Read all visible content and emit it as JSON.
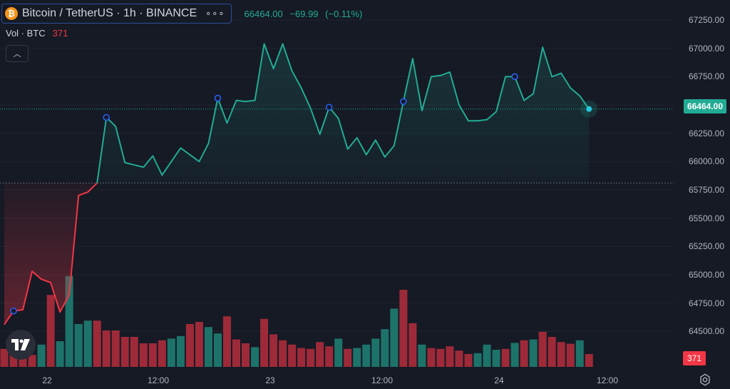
{
  "header": {
    "symbol_title": "Bitcoin / TetherUS · 1h · BINANCE",
    "coin_glyph": "₿",
    "more_glyph": "∘∘∘",
    "last": "66464.00",
    "change": "−69.99",
    "change_pct": "(−0.11%)"
  },
  "volume_legend": {
    "label": "Vol · BTC",
    "value": "371"
  },
  "collapse_glyph": "︿",
  "price_axis": {
    "ticks": [
      "67250.00",
      "67000.00",
      "66750.00",
      "66500.00",
      "66250.00",
      "66000.00",
      "65750.00",
      "65500.00",
      "65250.00",
      "65000.00",
      "64750.00",
      "64500.00"
    ],
    "current_price_label": "66464.00",
    "current_volume_label": "371"
  },
  "time_axis": {
    "ticks": [
      "22",
      "12:00",
      "23",
      "12:00",
      "24",
      "12:00"
    ]
  },
  "colors": {
    "up": "#22ab94",
    "down": "#f23645",
    "background": "#161a25"
  },
  "chart_data": {
    "type": "line",
    "title": "Bitcoin / TetherUS · 1h · BINANCE",
    "ylim": [
      64400,
      67320
    ],
    "baseline": 65810,
    "price": [
      64560,
      64680,
      64690,
      65030,
      64960,
      64930,
      64670,
      64820,
      65700,
      65730,
      65810,
      66390,
      66310,
      65990,
      65970,
      65950,
      66050,
      65880,
      66000,
      66120,
      66060,
      66000,
      66160,
      66560,
      66340,
      66540,
      66530,
      66540,
      67040,
      66820,
      67040,
      66800,
      66650,
      66470,
      66240,
      66480,
      66380,
      66110,
      66210,
      66060,
      66190,
      66040,
      66140,
      66530,
      66910,
      66450,
      66750,
      66760,
      66790,
      66500,
      66360,
      66360,
      66370,
      66440,
      66750,
      66750,
      66540,
      66600,
      67010,
      66750,
      66780,
      66650,
      66580,
      66464
    ],
    "volume": [
      42,
      30,
      38,
      28,
      52,
      168,
      60,
      212,
      100,
      108,
      108,
      85,
      85,
      70,
      70,
      55,
      55,
      62,
      66,
      72,
      100,
      105,
      93,
      78,
      118,
      64,
      55,
      46,
      112,
      76,
      62,
      52,
      44,
      42,
      58,
      48,
      66,
      42,
      44,
      52,
      66,
      88,
      136,
      180,
      102,
      52,
      44,
      42,
      48,
      38,
      30,
      32,
      52,
      40,
      42,
      56,
      62,
      64,
      82,
      70,
      58,
      54,
      62,
      30
    ],
    "bar_colors": [
      "d",
      "d",
      "d",
      "d",
      "u",
      "d",
      "u",
      "u",
      "u",
      "u",
      "d",
      "d",
      "d",
      "d",
      "d",
      "d",
      "d",
      "d",
      "u",
      "u",
      "d",
      "d",
      "u",
      "u",
      "d",
      "d",
      "d",
      "u",
      "d",
      "d",
      "d",
      "d",
      "d",
      "d",
      "d",
      "d",
      "u",
      "d",
      "u",
      "u",
      "u",
      "u",
      "u",
      "d",
      "d",
      "u",
      "d",
      "d",
      "d",
      "d",
      "d",
      "u",
      "u",
      "u",
      "d",
      "u",
      "d",
      "u",
      "d",
      "d",
      "d",
      "d",
      "u",
      "d"
    ],
    "marker_indices": [
      1,
      11,
      23,
      35,
      43,
      55
    ]
  }
}
